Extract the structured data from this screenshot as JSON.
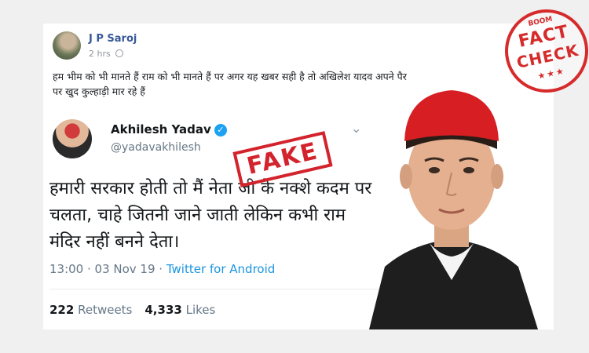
{
  "facebook": {
    "author": "J P Saroj",
    "time": "2 hrs",
    "post_text": "हम भीम को भी मानते हैं राम को भी मानते हैं पर अगर यह खबर सही है तो अखिलेश यादव अपने पैर पर खुद कुल्हाड़ी मार रहे हैं"
  },
  "tweet": {
    "name": "Akhilesh Yadav",
    "handle": "@yadavakhilesh",
    "body": "हमारी सरकार होती तो मैं नेता जी के नक्शे कदम पर चलता, चाहे जितनी जाने जाती लेकिन कभी राम मंदिर नहीं बनने देता।",
    "time": "13:00 · 03 Nov 19 ·",
    "source": "Twitter for Android",
    "retweets_count": "222",
    "retweets_label": "Retweets",
    "likes_count": "4,333",
    "likes_label": "Likes"
  },
  "stamp": {
    "fake_text": "FAKE"
  },
  "badge": {
    "brand": "BOOM",
    "line1": "FACT",
    "line2": "CHECK",
    "stars": "★★★"
  },
  "colors": {
    "fb_link": "#385898",
    "twitter_blue": "#1da1f2",
    "stamp_red": "#d3232c"
  },
  "icons": {
    "verified": "verified-badge-icon",
    "chevron": "chevron-down-icon",
    "privacy": "globe-icon"
  }
}
